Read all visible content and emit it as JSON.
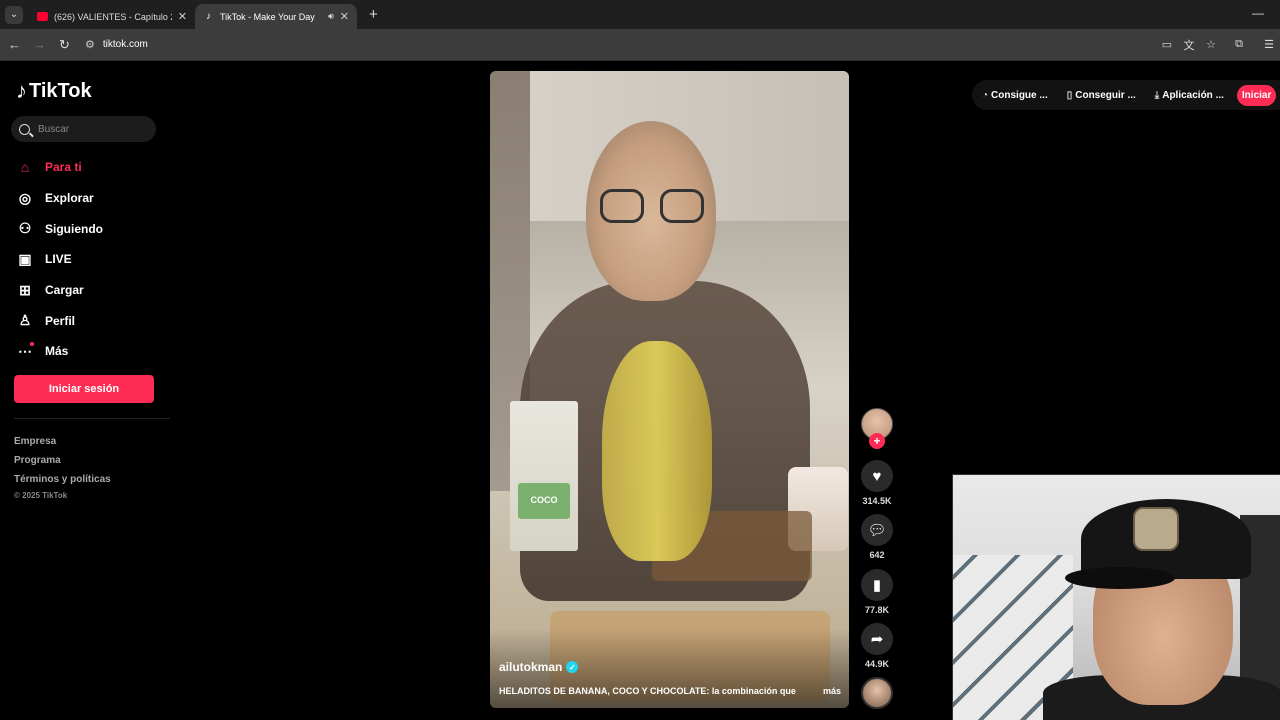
{
  "browser": {
    "tabs": [
      {
        "title": "(626) VALIENTES - Capítulo 2 -",
        "favicon": "youtube-icon",
        "active": false
      },
      {
        "title": "TikTok - Make Your Day",
        "favicon": "tiktok-icon",
        "active": true
      }
    ],
    "url": "tiktok.com"
  },
  "brand": {
    "name": "TikTok",
    "accent": "#fe2c55"
  },
  "search": {
    "placeholder": "Buscar"
  },
  "sidebar": {
    "items": [
      {
        "label": "Para ti",
        "icon": "home-icon",
        "active": true
      },
      {
        "label": "Explorar",
        "icon": "compass-icon"
      },
      {
        "label": "Siguiendo",
        "icon": "following-icon"
      },
      {
        "label": "LIVE",
        "icon": "live-icon"
      },
      {
        "label": "Cargar",
        "icon": "upload-icon"
      },
      {
        "label": "Perfil",
        "icon": "profile-icon"
      },
      {
        "label": "Más",
        "icon": "more-icon"
      }
    ],
    "login_label": "Iniciar sesión",
    "footer": [
      "Empresa",
      "Programa",
      "Términos y políticas"
    ],
    "copyright": "© 2025 TikTok"
  },
  "topbar": {
    "buttons": [
      {
        "label": "Consigue ...",
        "icon": "coin-icon"
      },
      {
        "label": "Conseguir ...",
        "icon": "phone-icon"
      },
      {
        "label": "Aplicación ...",
        "icon": "download-icon"
      }
    ],
    "signin_label": "Iniciar"
  },
  "video": {
    "author": "ailutokman",
    "caption": "HELADITOS DE BANANA, COCO Y CHOCOLATE: la combinación que",
    "more_label": "más",
    "carton_label": "COCO",
    "stats": {
      "likes": "314.5K",
      "comments": "642",
      "saves": "77.8K",
      "shares": "44.9K"
    }
  }
}
